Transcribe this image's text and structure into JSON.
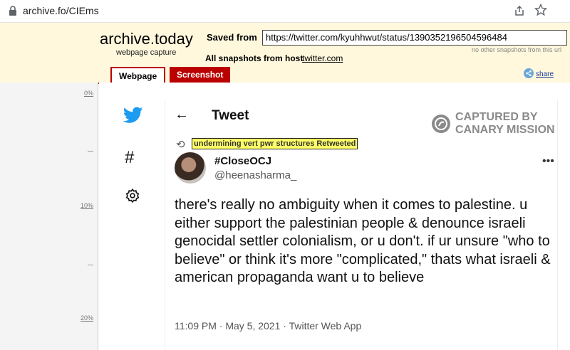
{
  "browser": {
    "url": "archive.fo/CIEms"
  },
  "archive": {
    "brand": "archive.today",
    "subbrand": "webpage capture",
    "saved_from_label": "Saved from",
    "saved_from_url": "https://twitter.com/kyuhhwut/status/1390352196504596484",
    "no_other": "no other snapshots from this url",
    "all_snapshots_label": "All snapshots  from host",
    "host": "twitter.com",
    "tabs": [
      "Webpage",
      "Screenshot"
    ],
    "share_label": "share"
  },
  "ruler": {
    "marks": [
      "0%",
      "10%",
      "20%"
    ]
  },
  "twitter": {
    "header_title": "Tweet",
    "watermark": [
      "CAPTURED BY",
      "CANARY MISSION"
    ],
    "retweet_label": "undermining vert pwr structures Retweeted",
    "display_name": "#CloseOCJ",
    "handle": "@heenasharma_",
    "more": "•••",
    "text": "there's really no ambiguity when it comes to palestine. u either support the palestinian people & denounce israeli genocidal settler colonialism, or u don't. if ur unsure \"who to believe\" or think it's more \"complicated,\" thats what israeli & american propaganda want u to believe",
    "meta": "11:09 PM · May 5, 2021 · Twitter Web App"
  },
  "icons": [
    "lock-icon",
    "share-icon",
    "star-icon",
    "twitter-bird-icon",
    "hashtag-icon",
    "gear-icon",
    "back-arrow-icon",
    "retweet-icon",
    "more-icon"
  ],
  "colors": {
    "archive_bg": "#fff8dd",
    "archive_red": "#bb0000",
    "twitter_blue": "#1d9bf0",
    "highlight": "#ffff66"
  }
}
